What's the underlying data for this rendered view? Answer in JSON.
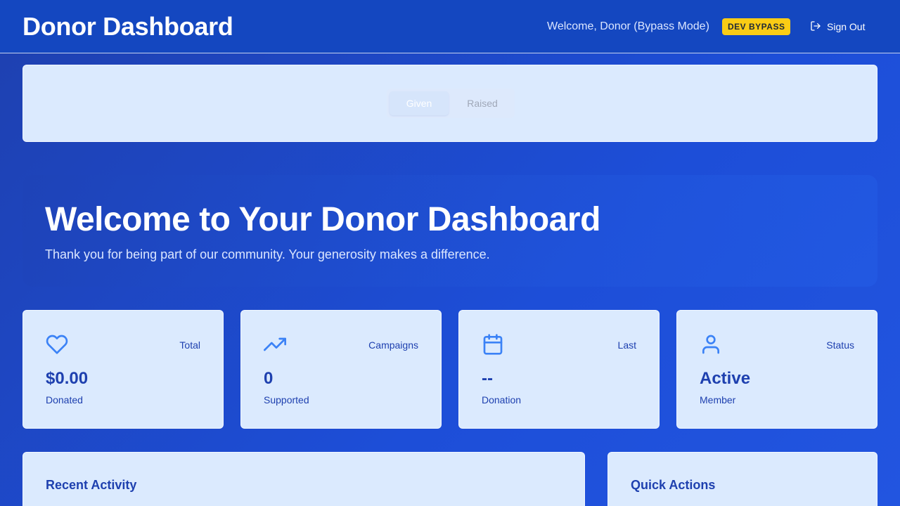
{
  "header": {
    "title": "Donor Dashboard",
    "welcome": "Welcome, Donor (Bypass Mode)",
    "badge": "DEV BYPASS",
    "signout_label": "Sign Out"
  },
  "tabs": [
    {
      "label": "Given",
      "active": true
    },
    {
      "label": "Raised",
      "active": false
    }
  ],
  "hero": {
    "title": "Welcome to Your Donor Dashboard",
    "subtitle": "Thank you for being part of our community. Your generosity makes a difference."
  },
  "stats": [
    {
      "icon": "heart-icon",
      "label": "Total",
      "value": "$0.00",
      "caption": "Donated"
    },
    {
      "icon": "trending-up-icon",
      "label": "Campaigns",
      "value": "0",
      "caption": "Supported"
    },
    {
      "icon": "calendar-icon",
      "label": "Last",
      "value": "--",
      "caption": "Donation"
    },
    {
      "icon": "user-icon",
      "label": "Status",
      "value": "Active",
      "caption": "Member"
    }
  ],
  "panels": {
    "recent_activity": "Recent Activity",
    "quick_actions": "Quick Actions"
  },
  "colors": {
    "background": "#1d4ed8",
    "card": "#dbeafe",
    "accent": "#1e40af",
    "icon": "#3b82f6",
    "badge": "#facc15"
  }
}
